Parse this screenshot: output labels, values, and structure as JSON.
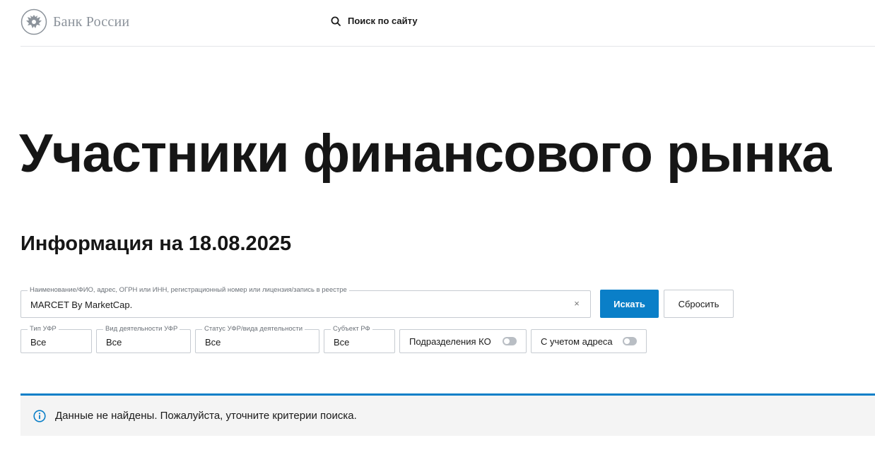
{
  "header": {
    "logo_text": "Банк России",
    "site_search_label": "Поиск по сайту"
  },
  "page": {
    "title": "Участники финансового рынка",
    "info_date": "Информация на 18.08.2025"
  },
  "search": {
    "label": "Наименование/ФИО, адрес, ОГРН или ИНН, регистрационный номер или лицензия/запись в реестре",
    "value": "MARCET By MarketCap.",
    "clear_glyph": "×",
    "submit_label": "Искать",
    "reset_label": "Сбросить"
  },
  "filters": [
    {
      "label": "Тип УФР",
      "value": "Все"
    },
    {
      "label": "Вид деятельности УФР",
      "value": "Все"
    },
    {
      "label": "Статус УФР/вида деятельности",
      "value": "Все"
    },
    {
      "label": "Субъект РФ",
      "value": "Все"
    }
  ],
  "toggles": [
    {
      "label": "Подразделения КО",
      "on": false
    },
    {
      "label": "С учетом адреса",
      "on": false
    }
  ],
  "alert": {
    "text": "Данные не найдены. Пожалуйста, уточните критерии поиска."
  },
  "colors": {
    "accent": "#0a7fc8",
    "logo_gray": "#8c939b",
    "border": "#c6cbd1",
    "alert_bg": "#f4f4f4"
  },
  "icons": {
    "logo": "double-headed-eagle-icon",
    "site_search": "search-icon",
    "clear": "close-icon",
    "alert": "info-icon"
  }
}
